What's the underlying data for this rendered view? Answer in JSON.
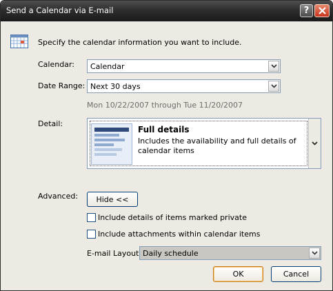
{
  "window": {
    "title": "Send a Calendar via E-mail"
  },
  "intro": {
    "text": "Specify the calendar information you want to include."
  },
  "calendar": {
    "label": "Calendar:",
    "value": "Calendar"
  },
  "date_range": {
    "label": "Date Range:",
    "value": "Next 30 days",
    "summary": "Mon 10/22/2007 through Tue 11/20/2007"
  },
  "detail": {
    "label": "Detail:",
    "option_title": "Full details",
    "option_desc": "Includes the availability and full details of calendar items"
  },
  "advanced": {
    "label": "Advanced:",
    "hide_button": "Hide <<",
    "private_checkbox": {
      "label": "Include details of items marked private",
      "checked": false
    },
    "attachments_checkbox": {
      "label": "Include attachments within calendar items",
      "checked": false
    }
  },
  "layout": {
    "label": "E-mail Layout:",
    "value": "Daily schedule"
  },
  "buttons": {
    "ok": "OK",
    "cancel": "Cancel"
  },
  "icons": [
    "help-icon",
    "close-icon",
    "calendar-icon",
    "chevron-down-icon"
  ],
  "colors": {
    "titlebar": "#2e2e2e",
    "close": "#c7331c",
    "dialog_bg": "#eceae2",
    "summary_text": "#6d6d6d"
  }
}
